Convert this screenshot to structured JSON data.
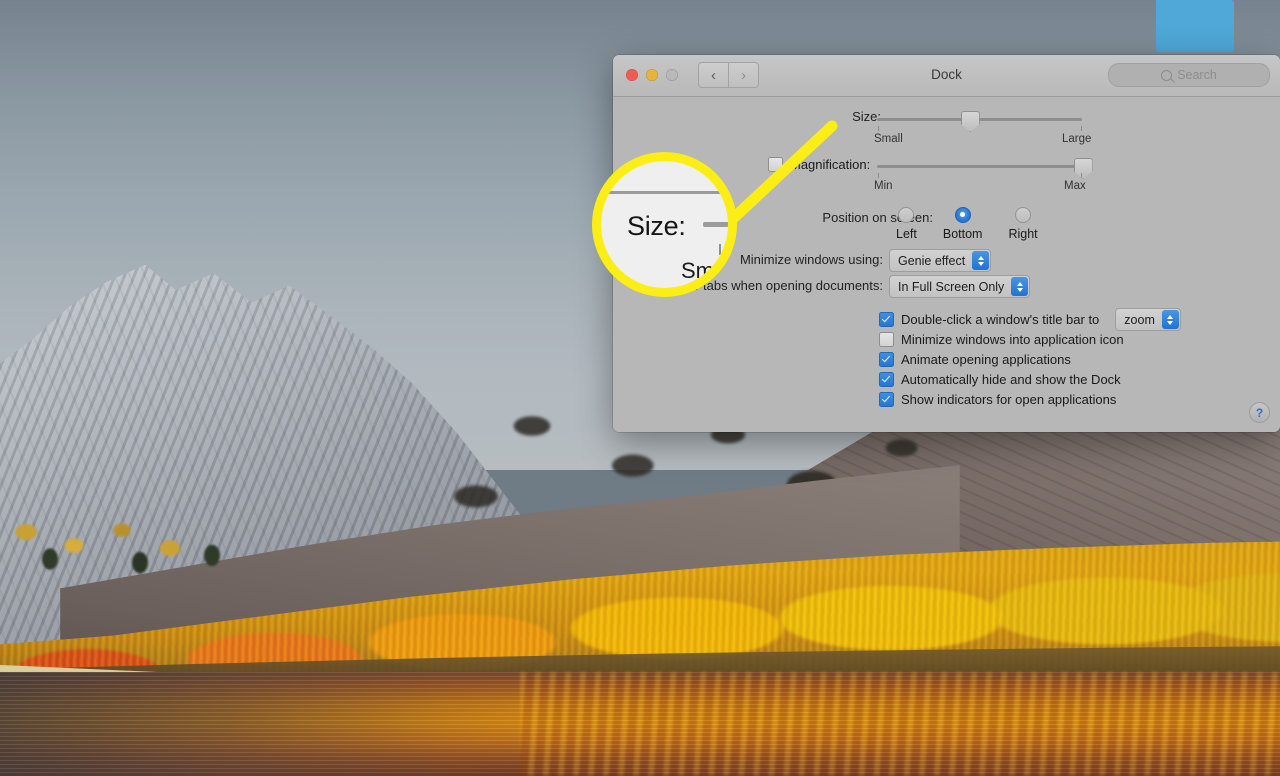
{
  "desktop": {
    "wallpaper_name": "macos-high-sierra-lake-mountain",
    "folder_icon_name": "blue-folder",
    "folder_color": "#4fa8d8"
  },
  "window": {
    "title": "Dock",
    "traffic_lights": [
      {
        "name": "close",
        "color": "#f05c52"
      },
      {
        "name": "minimize",
        "color": "#e6b33c"
      },
      {
        "name": "zoom",
        "color": "#b9b9b9"
      }
    ],
    "nav": {
      "back": "‹",
      "forward": "›"
    },
    "show_all_label": "show-all-grid",
    "search": {
      "value": "",
      "placeholder": "Search"
    }
  },
  "settings": {
    "size": {
      "label": "Size:",
      "min_label": "Small",
      "max_label": "Large",
      "value_percent": 45
    },
    "magnification": {
      "label": "Magnification:",
      "checked": false,
      "min_label": "Min",
      "max_label": "Max",
      "value_percent": 100
    },
    "position": {
      "label": "Position on screen:",
      "options": [
        "Left",
        "Bottom",
        "Right"
      ],
      "selected": "Bottom"
    },
    "minimize_effect": {
      "label": "Minimize windows using:",
      "value": "Genie effect"
    },
    "prefer_tabs": {
      "label": "Prefer tabs when opening documents:",
      "value": "In Full Screen Only"
    },
    "checkboxes": [
      {
        "label": "Double-click a window's title bar to",
        "checked": true,
        "popup_value": "zoom"
      },
      {
        "label": "Minimize windows into application icon",
        "checked": false
      },
      {
        "label": "Animate opening applications",
        "checked": true
      },
      {
        "label": "Automatically hide and show the Dock",
        "checked": true
      },
      {
        "label": "Show indicators for open applications",
        "checked": true
      }
    ],
    "help_label": "?"
  },
  "callout": {
    "magnified_label": "Size:",
    "magnified_sublabel": "Sm",
    "ring_color": "#fbee16"
  }
}
